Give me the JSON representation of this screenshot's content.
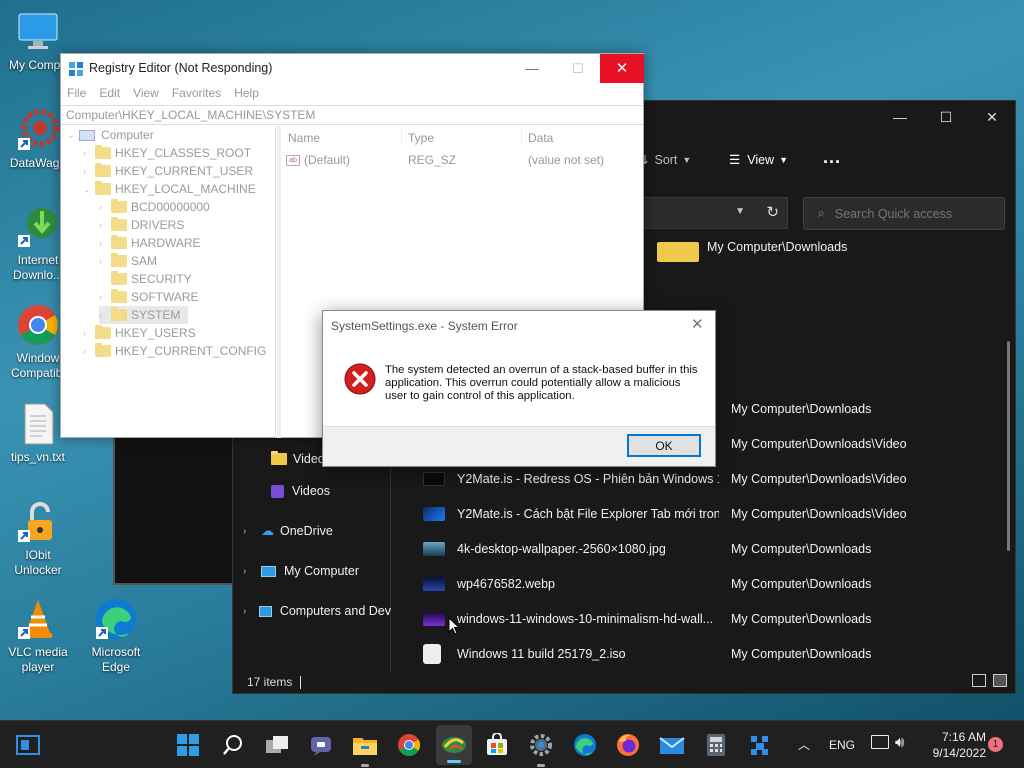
{
  "desktop": {
    "icons": [
      {
        "label": "My Compu"
      },
      {
        "label": "DataWago"
      },
      {
        "label": "Internet\nDownlo..."
      },
      {
        "label": "Window\nCompatibi"
      },
      {
        "label": "tips_vn.txt"
      },
      {
        "label": "IObit\nUnlocker"
      },
      {
        "label": "VLC media\nplayer"
      },
      {
        "label": "Microsoft\nEdge"
      }
    ]
  },
  "explorer": {
    "toolbar": {
      "sort_label": "Sort",
      "view_label": "View",
      "more": "..."
    },
    "search_placeholder": "Search Quick access",
    "folder_row": {
      "location": "My Computer\\Downloads"
    },
    "nav": [
      {
        "label": "Video"
      },
      {
        "label": "Videos"
      },
      {
        "label": "OneDrive"
      },
      {
        "label": "My Computer"
      },
      {
        "label": "Computers and Dev"
      }
    ],
    "files": [
      {
        "name": "",
        "location": "My Computer\\Downloads"
      },
      {
        "name": "",
        "location": "My Computer\\Downloads\\Video"
      },
      {
        "name": "Y2Mate.is - Redress OS - Phiên bản Windows 1...",
        "location": "My Computer\\Downloads\\Video"
      },
      {
        "name": "Y2Mate.is - Cách bật File Explorer Tab mới tron...",
        "location": "My Computer\\Downloads\\Video"
      },
      {
        "name": "4k-desktop-wallpaper.-2560×1080.jpg",
        "location": "My Computer\\Downloads"
      },
      {
        "name": "wp4676582.webp",
        "location": "My Computer\\Downloads"
      },
      {
        "name": "windows-11-windows-10-minimalism-hd-wall...",
        "location": "My Computer\\Downloads"
      },
      {
        "name": "Windows 11 build 25179_2.iso",
        "location": "My Computer\\Downloads"
      }
    ],
    "status": "17 items"
  },
  "regedit": {
    "title": "Registry Editor (Not Responding)",
    "menu": [
      "File",
      "Edit",
      "View",
      "Favorites",
      "Help"
    ],
    "address": "Computer\\HKEY_LOCAL_MACHINE\\SYSTEM",
    "tree": [
      "Computer",
      "HKEY_CLASSES_ROOT",
      "HKEY_CURRENT_USER",
      "HKEY_LOCAL_MACHINE",
      "BCD00000000",
      "DRIVERS",
      "HARDWARE",
      "SAM",
      "SECURITY",
      "SOFTWARE",
      "SYSTEM",
      "HKEY_USERS",
      "HKEY_CURRENT_CONFIG"
    ],
    "columns": {
      "name": "Name",
      "type": "Type",
      "data": "Data"
    },
    "values": [
      {
        "name": "(Default)",
        "type": "REG_SZ",
        "data": "(value not set)"
      }
    ]
  },
  "dialog": {
    "title": "SystemSettings.exe - System Error",
    "message": "The system detected an overrun of a stack-based buffer in this application. This overrun could potentially allow a malicious user to gain control of this application.",
    "ok_label": "OK"
  },
  "taskbar": {
    "lang": "ENG",
    "time": "7:16 AM",
    "date": "9/14/2022",
    "notification_count": "1"
  },
  "colors": {
    "accent": "#0078d4",
    "error_red": "#d11f1f",
    "close_red": "#e81123"
  }
}
